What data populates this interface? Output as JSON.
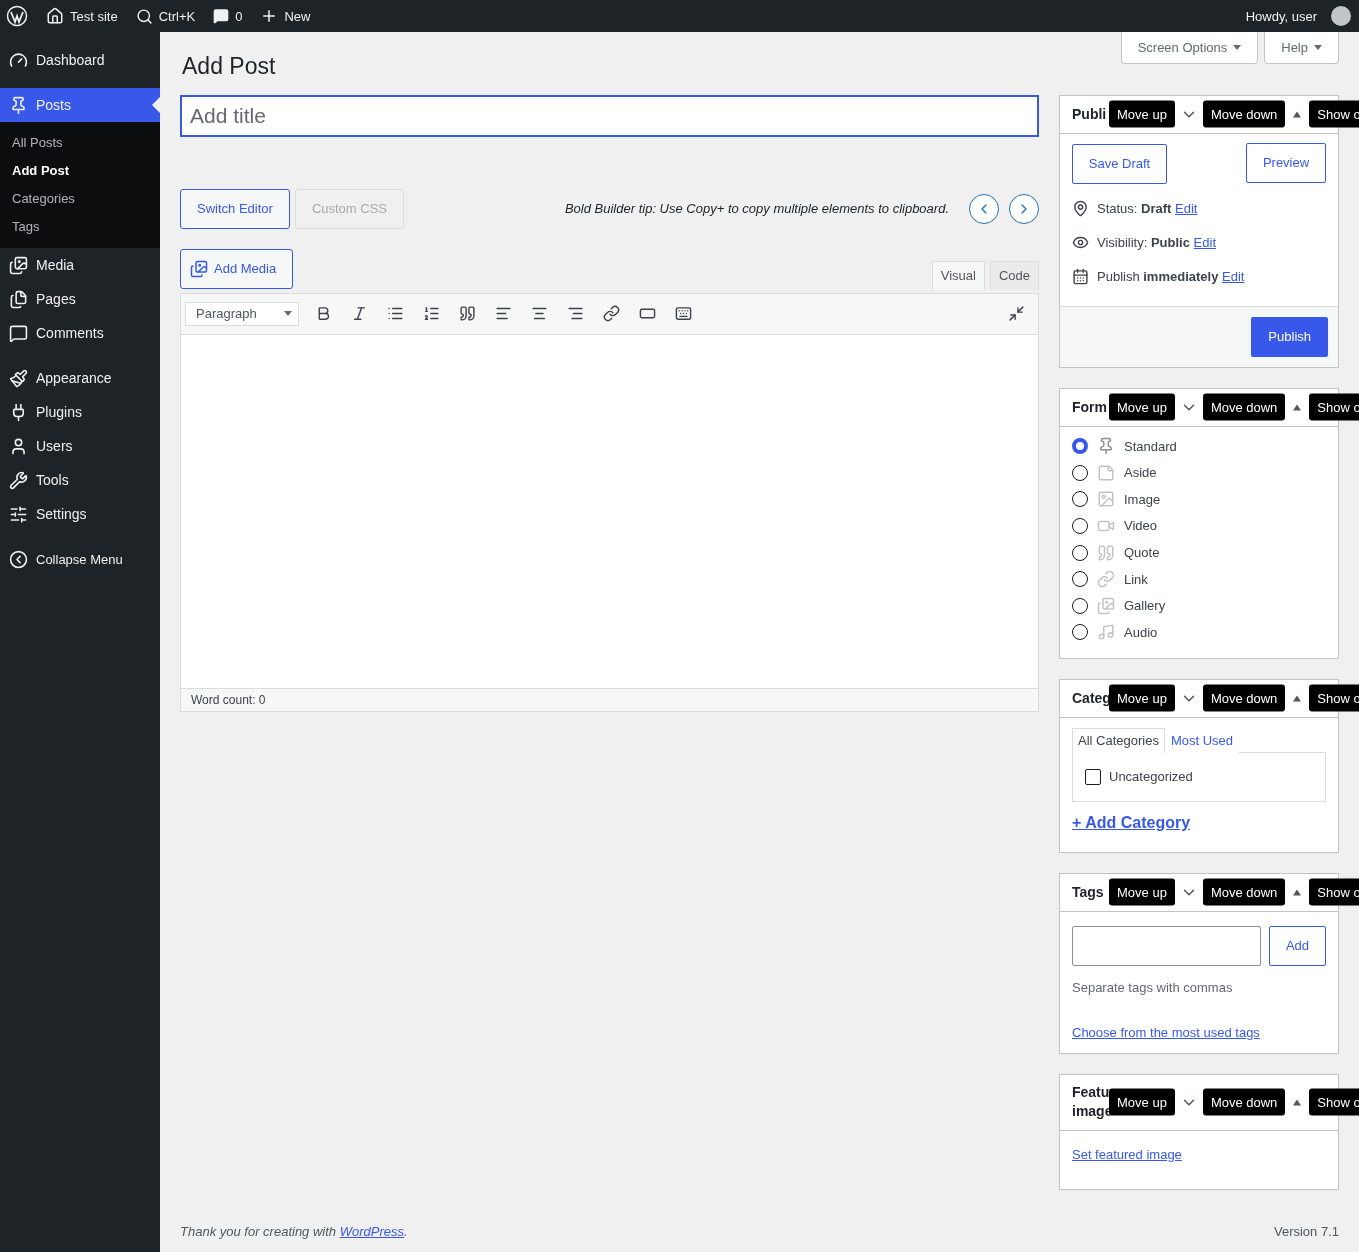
{
  "admin_bar": {
    "site": "Test site",
    "search": "Ctrl+K",
    "comments": "0",
    "new": "New",
    "greeting": "Howdy, user"
  },
  "sidebar": {
    "groups": [
      [
        {
          "label": "Dashboard",
          "selected": false
        }
      ],
      [
        {
          "label": "Posts",
          "selected": true,
          "children": [
            {
              "label": "All Posts",
              "selected": false
            },
            {
              "label": "Add Post",
              "selected": true
            },
            {
              "label": "Categories",
              "selected": false
            },
            {
              "label": "Tags",
              "selected": false
            }
          ]
        },
        {
          "label": "Media",
          "selected": false
        },
        {
          "label": "Pages",
          "selected": false
        },
        {
          "label": "Comments",
          "selected": false
        }
      ],
      [
        {
          "label": "Appearance",
          "selected": false
        },
        {
          "label": "Plugins",
          "selected": false
        },
        {
          "label": "Users",
          "selected": false
        },
        {
          "label": "Tools",
          "selected": false
        },
        {
          "label": "Settings",
          "selected": false
        }
      ],
      [
        {
          "label": "Collapse Menu",
          "selected": false,
          "kind": "collapse"
        }
      ]
    ]
  },
  "screen_tabs": [
    "Screen Options",
    "Help"
  ],
  "page_title": "Add Post",
  "title_field": {
    "placeholder": "Add title"
  },
  "editor_buttons": [
    {
      "label": "Switch Editor",
      "disabled": false
    },
    {
      "label": "Custom CSS",
      "disabled": true
    }
  ],
  "tip": "Bold Builder tip: Use Copy+ to copy multiple elements to clipboard.",
  "add_media": "Add Media",
  "editor_tabs": [
    {
      "label": "Visual",
      "selected": true
    },
    {
      "label": "Code",
      "selected": false
    }
  ],
  "format_select": "Paragraph",
  "word_count": "Word count: 0",
  "publish_box": {
    "title": [
      "Publi"
    ],
    "tooltips": [
      "Move up",
      "Move down",
      "Show o"
    ],
    "save_draft": "Save Draft",
    "preview": "Preview",
    "rows": [
      {
        "kind": "status",
        "text": "Status: **Draft**",
        "link": "Edit"
      },
      {
        "kind": "visibility",
        "text": "Visibility: **Public**",
        "link": "Edit"
      },
      {
        "kind": "schedule",
        "text": "Publish **immediately**",
        "link": "Edit"
      }
    ],
    "publish": "Publish"
  },
  "format_box": {
    "title": [
      "Form"
    ],
    "tooltips": [
      "Move up",
      "Move down",
      "Show o"
    ],
    "options": [
      {
        "kind": "standard",
        "label": "Standard",
        "selected": true
      },
      {
        "kind": "aside",
        "label": "Aside",
        "selected": false
      },
      {
        "kind": "image",
        "label": "Image",
        "selected": false
      },
      {
        "kind": "video",
        "label": "Video",
        "selected": false
      },
      {
        "kind": "quote",
        "label": "Quote",
        "selected": false
      },
      {
        "kind": "link",
        "label": "Link",
        "selected": false
      },
      {
        "kind": "gallery",
        "label": "Gallery",
        "selected": false
      },
      {
        "kind": "audio",
        "label": "Audio",
        "selected": false
      }
    ]
  },
  "categories_box": {
    "title": [
      "Categ"
    ],
    "tooltips": [
      "Move up",
      "Move down",
      "Show o"
    ],
    "tabs": [
      {
        "label": "All Categories",
        "selected": true
      },
      {
        "label": "Most Used",
        "selected": false
      }
    ],
    "items": [
      {
        "label": "Uncategorized",
        "checked": false
      }
    ],
    "add_link": "+ Add Category"
  },
  "tags_box": {
    "title": [
      "Tags"
    ],
    "tooltips": [
      "Move up",
      "Move down",
      "Show o"
    ],
    "add": "Add",
    "hint": "Separate tags with commas",
    "link": "Choose from the most used tags"
  },
  "featured_box": {
    "title": [
      "Featu",
      "image"
    ],
    "tooltips": [
      "Move up",
      "Move down",
      "Show o"
    ],
    "link": "Set featured image"
  },
  "footer": {
    "text": "Thank you for creating with ",
    "link": "WordPress",
    "end": ".",
    "version": "Version 7.1"
  }
}
